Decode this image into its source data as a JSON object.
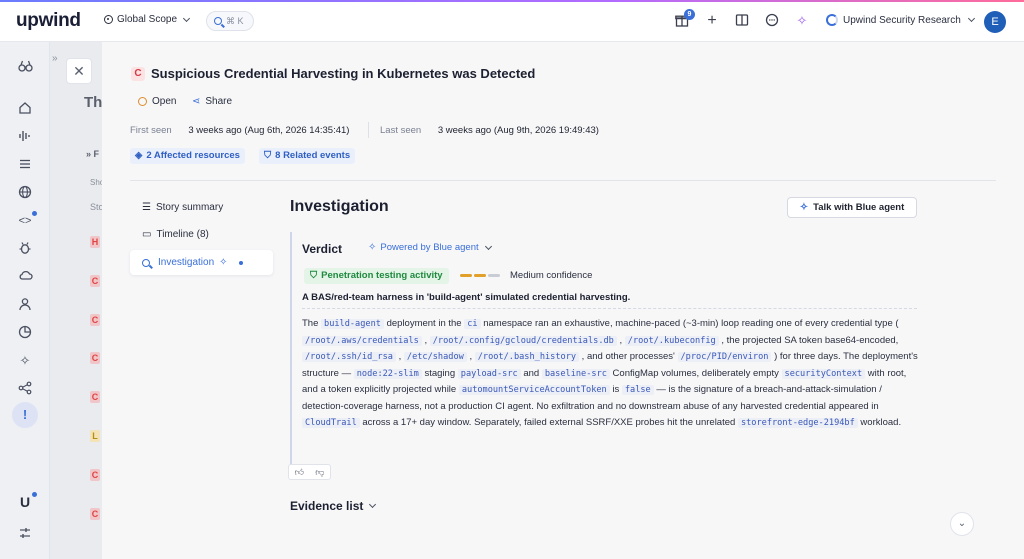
{
  "topbar": {
    "logo": "upwind",
    "scope_label": "Global Scope",
    "search_shortcut": "⌘ K",
    "gift_badge_count": "9",
    "org_name": "Upwind Security Research",
    "avatar_initial": "E"
  },
  "rail": {
    "icons": [
      "binoculars-icon",
      "home-icon",
      "waveform-icon",
      "list-icon",
      "globe-icon",
      "code-icon",
      "bug-icon",
      "cloud-icon",
      "user-icon",
      "chart-pie-icon",
      "sparkle-icon",
      "share-nodes-icon",
      "exclamation-icon",
      "upwind-u-icon",
      "sliders-icon"
    ],
    "active": "exclamation-icon"
  },
  "underlying": {
    "title_fragment": "Th",
    "filter_fragment": "F",
    "small1": "Sho",
    "small2": "Sto",
    "row_letters": [
      "H",
      "C",
      "C",
      "C",
      "C",
      "L",
      "C",
      "C"
    ]
  },
  "drawer": {
    "severity_letter": "C",
    "title": "Suspicious Credential Harvesting in Kubernetes was Detected",
    "open_label": "Open",
    "share_label": "Share",
    "first_seen_label": "First seen",
    "first_seen_value": "3 weeks ago (Aug 6th, 2026 14:35:41)",
    "last_seen_label": "Last seen",
    "last_seen_value": "3 weeks ago (Aug 9th, 2026 19:49:43)",
    "affected_resources": "2 Affected resources",
    "related_events": "8 Related events",
    "nav": {
      "story": "Story summary",
      "timeline": "Timeline (8)",
      "investigation": "Investigation"
    },
    "investigation": {
      "heading": "Investigation",
      "talk_button": "Talk with Blue agent",
      "verdict_label": "Verdict",
      "powered_by": "Powered by Blue agent",
      "classification": "Penetration testing activity",
      "confidence": "Medium confidence",
      "summary": "A BAS/red-team harness in 'build-agent' simulated credential harvesting.",
      "body": {
        "t1": "The ",
        "c1": "build-agent",
        "t2": " deployment in the ",
        "c2": "ci",
        "t3": " namespace ran an exhaustive, machine-paced (~3-min) loop reading one of every credential type ( ",
        "c3": "/root/.aws/credentials",
        "t4": " , ",
        "c4": "/root/.config/gcloud/credentials.db",
        "t5": " , ",
        "c5": "/root/.kubeconfig",
        "t6": " , the projected SA token base64-encoded, ",
        "c6": "/root/.ssh/id_rsa",
        "t7": " , ",
        "c7": "/etc/shadow",
        "t8": " , ",
        "c8": "/root/.bash_history",
        "t9": " , and other processes' ",
        "c9": "/proc/PID/environ",
        "t10": " ) for three days. The deployment's structure — ",
        "c10": "node:22-slim",
        "t11": " staging ",
        "c11": "payload-src",
        "t12": " and ",
        "c12": "baseline-src",
        "t13": " ConfigMap volumes, deliberately empty ",
        "c13": "securityContext",
        "t14": " with root, and a token explicitly projected while ",
        "c14": "automountServiceAccountToken",
        "t15": " is ",
        "c15": "false",
        "t16": " — is the signature of a breach-and-attack-simulation / detection-coverage harness, not a production CI agent. No exfiltration and no downstream abuse of any harvested credential appeared in ",
        "c16": "CloudTrail",
        "t17": " across a 17+ day window. Separately, failed external SSRF/XXE probes hit the unrelated ",
        "c17": "storefront-edge-2194bf",
        "t18": " workload."
      }
    },
    "evidence_label": "Evidence list"
  },
  "colors": {
    "accent": "#3a6fd8",
    "critical": "#d63a45",
    "success": "#1f8a3e",
    "confidence_high": "#e0a02a",
    "confidence_low": "#c9ccd4"
  }
}
